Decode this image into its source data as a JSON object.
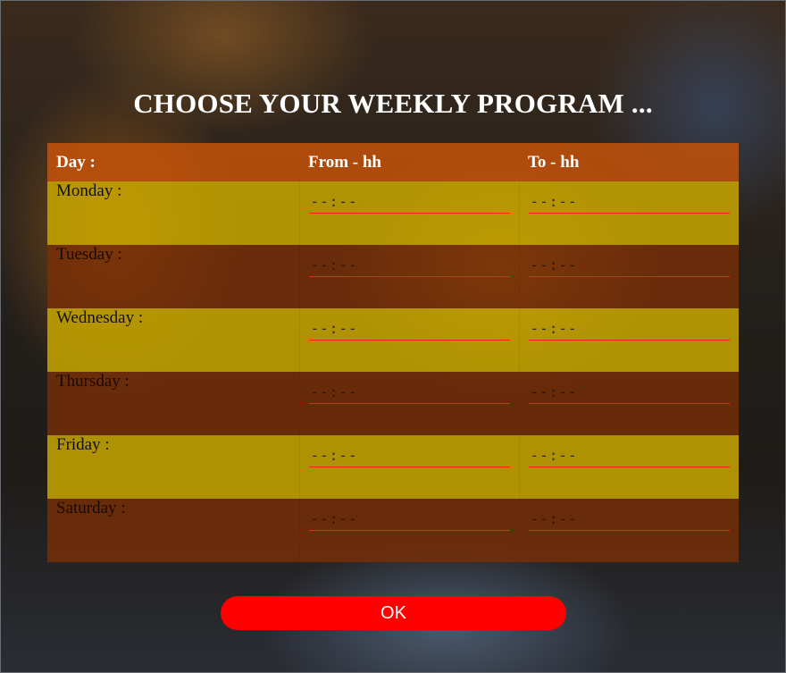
{
  "title": "CHOOSE YOUR WEEKLY PROGRAM ...",
  "table": {
    "headers": {
      "day": "Day :",
      "from": "From - hh",
      "to": "To - hh"
    },
    "time_placeholder": "--:--",
    "rows": [
      {
        "day": "Monday :",
        "from": "",
        "to": ""
      },
      {
        "day": "Tuesday :",
        "from": "",
        "to": ""
      },
      {
        "day": "Wednesday :",
        "from": "",
        "to": ""
      },
      {
        "day": "Thursday :",
        "from": "",
        "to": ""
      },
      {
        "day": "Friday :",
        "from": "",
        "to": ""
      },
      {
        "day": "Saturday :",
        "from": "",
        "to": ""
      }
    ]
  },
  "ok_button": {
    "label": "OK"
  },
  "colors": {
    "header_bg": "#c4520a",
    "row_yellow": "#c7a500",
    "row_brown": "#7a3006",
    "input_underline": "#ff1a1a",
    "button_bg": "#ff0000",
    "title_color": "#ffffff"
  }
}
